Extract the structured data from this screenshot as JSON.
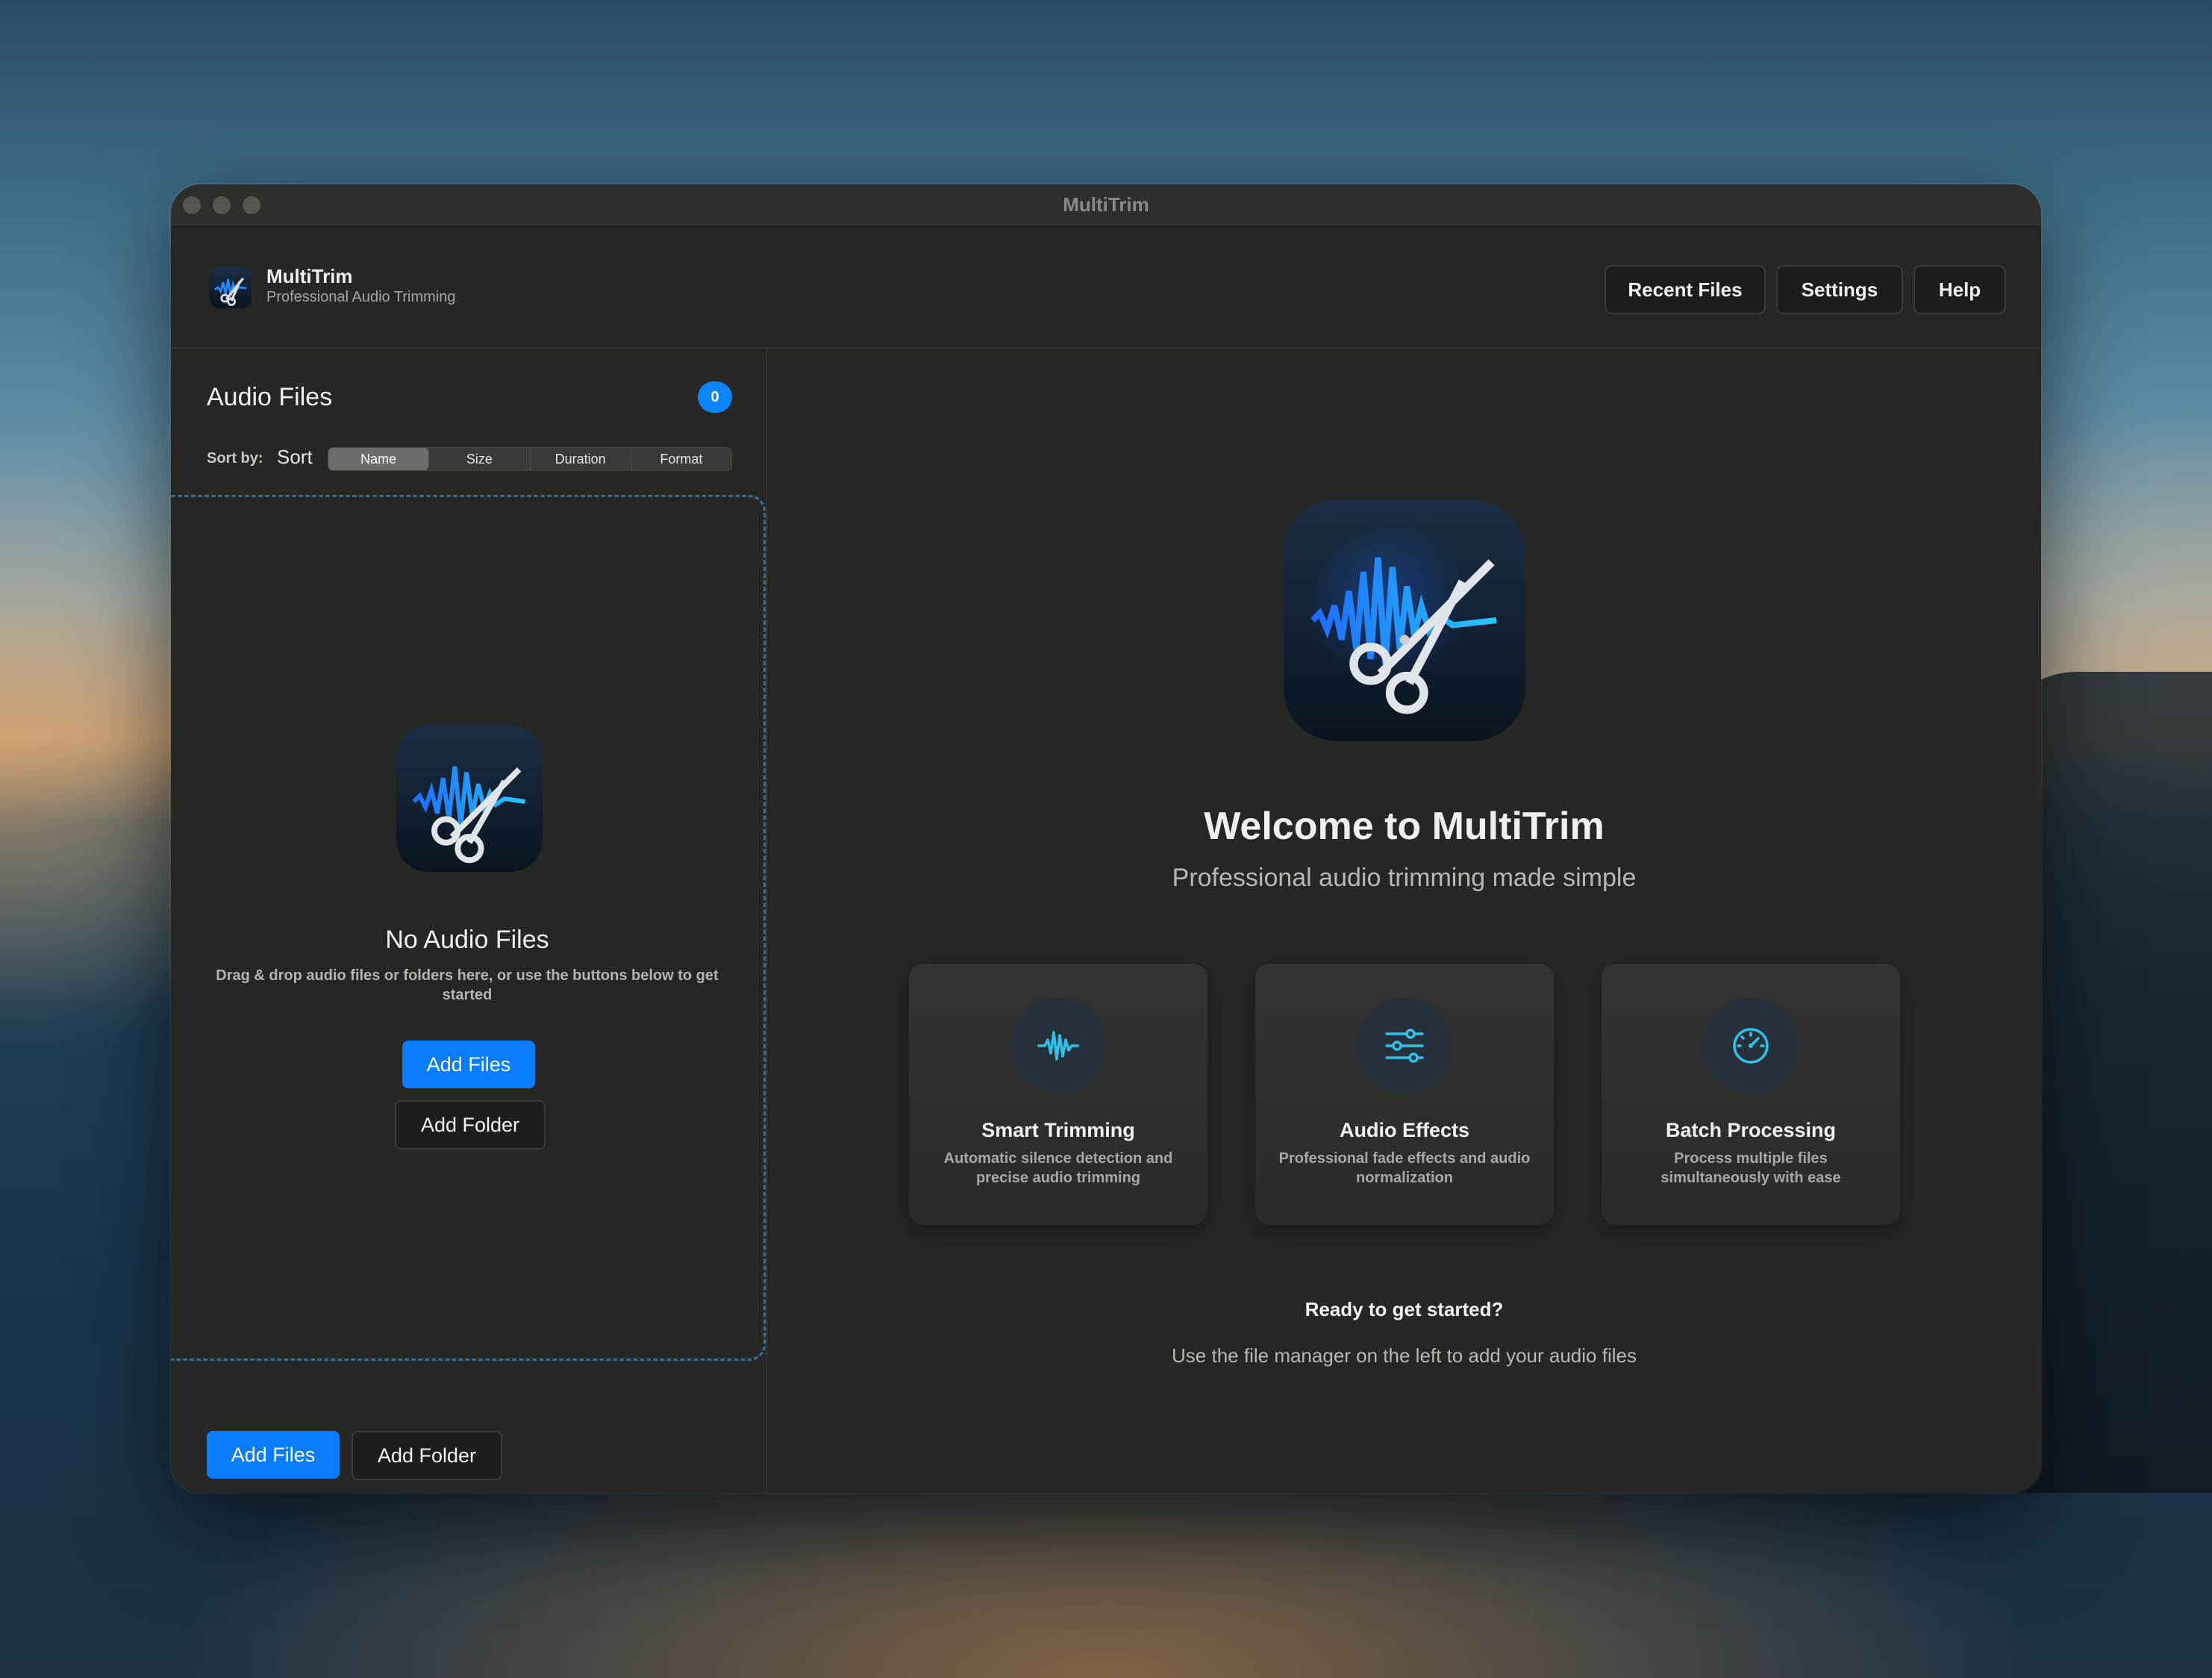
{
  "window": {
    "title": "MultiTrim"
  },
  "header": {
    "app_name": "MultiTrim",
    "app_subtitle": "Professional Audio Trimming",
    "buttons": {
      "recent": "Recent Files",
      "settings": "Settings",
      "help": "Help"
    }
  },
  "sidebar": {
    "title": "Audio Files",
    "count": "0",
    "sort_label": "Sort by:",
    "sort_word": "Sort",
    "sort_options": [
      "Name",
      "Size",
      "Duration",
      "Format"
    ],
    "sort_selected": "Name",
    "empty": {
      "title": "No Audio Files",
      "description": "Drag & drop audio files or folders here, or use the buttons below to get started",
      "add_files": "Add Files",
      "add_folder": "Add Folder"
    },
    "footer": {
      "add_files": "Add Files",
      "add_folder": "Add Folder"
    }
  },
  "main": {
    "welcome_title": "Welcome to MultiTrim",
    "welcome_subtitle": "Professional audio trimming made simple",
    "features": [
      {
        "title": "Smart Trimming",
        "description": "Automatic silence detection and precise audio trimming",
        "icon": "waveform-icon"
      },
      {
        "title": "Audio Effects",
        "description": "Professional fade effects and audio normalization",
        "icon": "sliders-icon"
      },
      {
        "title": "Batch Processing",
        "description": "Process multiple files simultaneously with ease",
        "icon": "gauge-icon"
      }
    ],
    "ready_title": "Ready to get started?",
    "ready_subtitle": "Use the file manager on the left to add your audio files"
  },
  "colors": {
    "accent": "#0a84ff",
    "icon_cyan": "#2ec4ea",
    "window_bg": "#262723"
  }
}
